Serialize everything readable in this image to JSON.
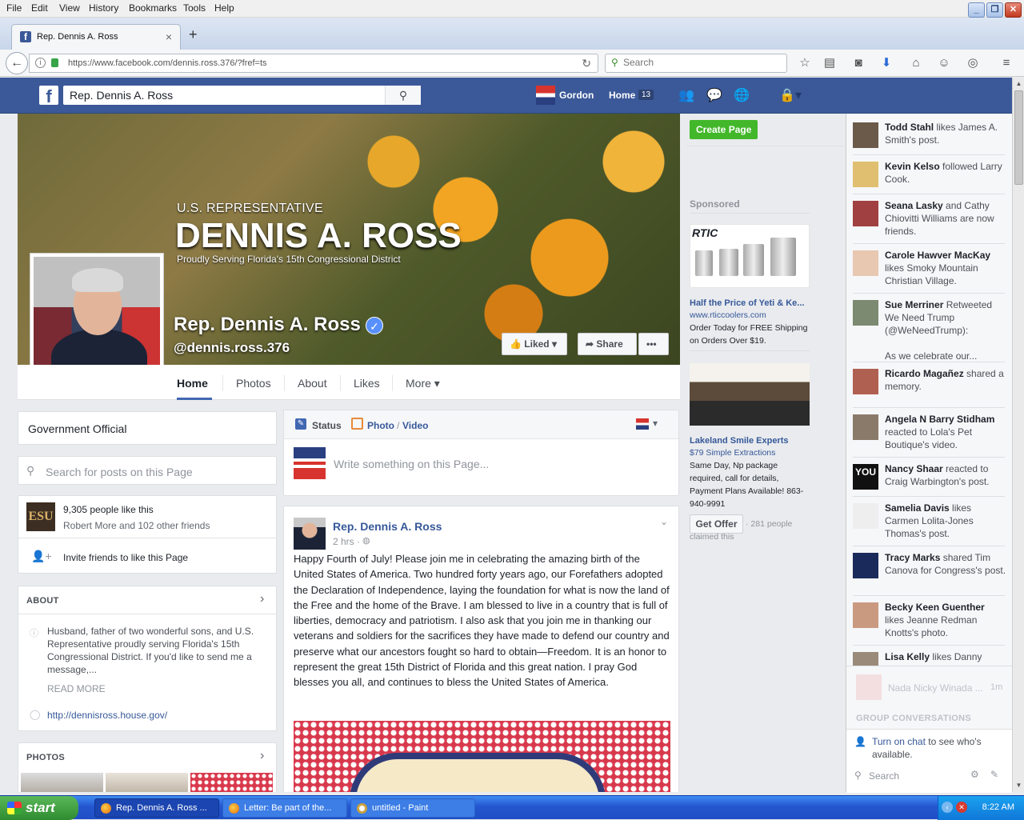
{
  "menubar": {
    "items": [
      "File",
      "Edit",
      "View",
      "History",
      "Bookmarks",
      "Tools",
      "Help"
    ]
  },
  "tab": {
    "title": "Rep. Dennis A. Ross",
    "close": "×",
    "new": "+"
  },
  "address": {
    "url": "https://www.facebook.com/dennis.ross.376/?fref=ts",
    "search_placeholder": "Search"
  },
  "fb": {
    "search_value": "Rep. Dennis A. Ross",
    "user": "Gordon",
    "home": "Home",
    "home_count": "13"
  },
  "cover": {
    "sub": "U.S. REPRESENTATIVE",
    "big": "DENNIS A. ROSS",
    "tag": "Proudly Serving Florida's 15th Congressional District",
    "page_name": "Rep. Dennis A. Ross",
    "handle": "@dennis.ross.376",
    "liked": "Liked",
    "share": "Share",
    "more": "•••"
  },
  "page_nav": [
    "Home",
    "Photos",
    "About",
    "Likes",
    "More ▾"
  ],
  "left": {
    "category": "Government Official",
    "search_placeholder": "Search for posts on this Page",
    "likes_count": "9,305 people like this",
    "likes_friends": "Robert More and 102 other friends",
    "invite": "Invite friends to like this Page",
    "about_header": "ABOUT",
    "about_text": "Husband, father of two wonderful sons, and U.S. Representative proudly serving Florida's 15th Congressional District. If you'd like to send me a message,...",
    "read_more": "READ MORE",
    "website": "http://dennisross.house.gov/",
    "photos_header": "PHOTOS",
    "esu": "ESU"
  },
  "composer": {
    "status": "Status",
    "photo": "Photo",
    "video": "Video",
    "sep": "/",
    "placeholder": "Write something on this Page..."
  },
  "post": {
    "author": "Rep. Dennis A. Ross",
    "time": "2 hrs ·",
    "body": "Happy Fourth of July! Please join me in celebrating the amazing birth of the United States of America. Two hundred forty years ago, our Forefathers adopted the Declaration of Independence, laying the foundation for what is now the land of the Free and the home of the Brave. I am blessed to live in a country that is full of liberties, democracy and patriotism. I also ask that you join me in thanking our veterans and soldiers for the sacrifices they have made to defend our country and preserve what our ancestors fought so hard to obtain—Freedom. It is an honor to represent the great 15th District of Florida and this great nation. I pray God blesses you all, and continues to bless the United States of America."
  },
  "ads": {
    "create_page": "Create Page",
    "sponsored": "Sponsored",
    "ad1_logo": "RTIC",
    "ad1_title": "Half the Price of Yeti & Ke...",
    "ad1_url": "www.rticcoolers.com",
    "ad1_text": "Order Today for FREE Shipping on Orders Over $19.",
    "ad2_title": "Lakeland Smile Experts",
    "ad2_url": "$79 Simple Extractions",
    "ad2_text": "Same Day, Np package required, call for details, Payment Plans Available! 863-940-9991",
    "ad2_btn": "Get Offer",
    "ad2_claimed": "· 281 people claimed this"
  },
  "ticker": [
    {
      "name": "Todd Stahl",
      "rest": " likes James A. Smith's post."
    },
    {
      "name": "Kevin Kelso",
      "rest": " followed Larry Cook."
    },
    {
      "name": "Seana Lasky",
      "rest": " and Cathy Chiovitti Williams are now friends."
    },
    {
      "name": "Carole Hawver MacKay",
      "rest": " likes Smoky Mountain Christian Village."
    },
    {
      "name": "Sue Merriner",
      "rest": " Retweeted We Need Trump (@WeNeedTrump):"
    },
    {
      "name": "Ricardo Magañez",
      "rest": " shared a memory."
    },
    {
      "name": "Angela N Barry Stidham",
      "rest": " reacted to Lola's Pet Boutique's video."
    },
    {
      "name": "Nancy Shaar",
      "rest": " reacted to Craig Warbington's post."
    },
    {
      "name": "Samelia Davis",
      "rest": " likes Carmen Lolita-Jones Thomas's post."
    },
    {
      "name": "Tracy Marks",
      "rest": " shared Tim Canova for Congress's post."
    },
    {
      "name": "Becky Keen Guenther",
      "rest": " likes Jeanne Redman Knotts's photo."
    },
    {
      "name": "Lisa Kelly",
      "rest": " likes Danny Garcia's post."
    }
  ],
  "ticker_extra": {
    "sue_quote": "As we celebrate our...",
    "chat_user": "Nada Nicky Winada ...",
    "chat_time": "1m",
    "group": "GROUP CONVERSATIONS",
    "turn_on": "Turn on chat",
    "turn_on_rest": " to see who's available.",
    "chat_search": "Search",
    "you_avatar": "YOU"
  },
  "taskbar": {
    "start": "start",
    "btn1": "Rep. Dennis A. Ross ...",
    "btn2": "Letter: Be part of the...",
    "btn3": "untitled - Paint",
    "time": "8:22 AM"
  },
  "colors": {
    "fb_blue": "#3b5998",
    "link": "#365899",
    "green": "#42b72a"
  }
}
